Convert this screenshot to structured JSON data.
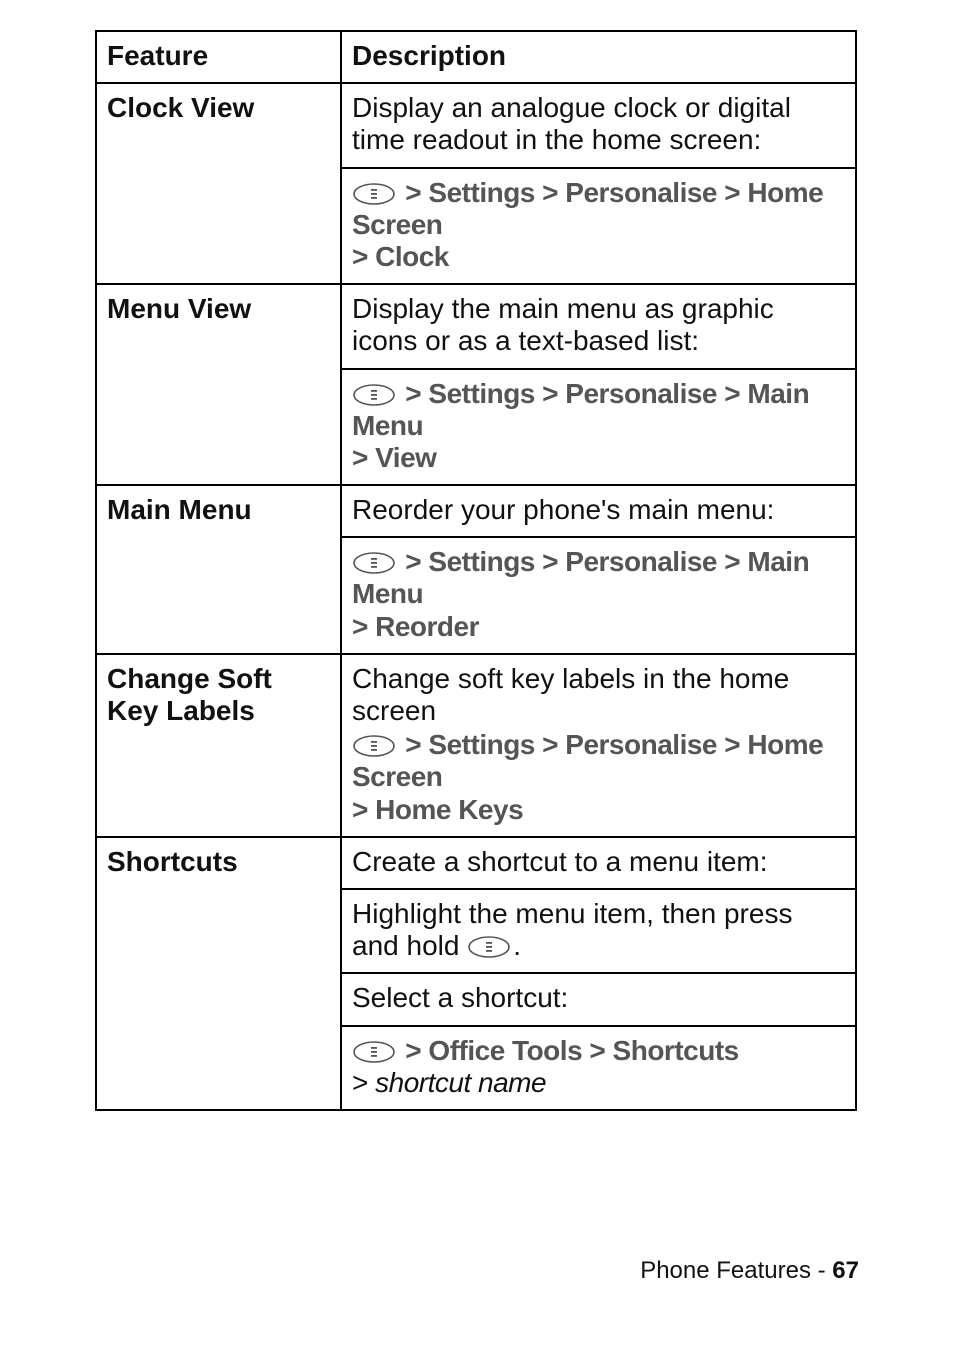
{
  "header": {
    "feature": "Feature",
    "description": "Description"
  },
  "rows": [
    {
      "feature": "Clock View",
      "intro": "Display an analogue clock or digital time readout in the home screen:",
      "path_prefix": " > ",
      "path_main": "Settings > Personalise > Home Screen",
      "path_cont": "> Clock"
    },
    {
      "feature": "Menu View",
      "intro": "Display the main menu as graphic icons or as a text-based list:",
      "path_prefix": " > ",
      "path_main": "Settings > Personalise > Main Menu",
      "path_cont": "> View"
    },
    {
      "feature": "Main Menu",
      "intro": "Reorder your phone's main menu:",
      "path_prefix": " > ",
      "path_main": "Settings > Personalise > Main Menu",
      "path_cont": "> Reorder"
    },
    {
      "feature": "Change Soft Key Labels",
      "intro": "Change soft key labels in the home screen",
      "path_prefix": " > ",
      "path_main": "Settings > Personalise > Home Screen",
      "path_cont": "> Home Keys"
    },
    {
      "feature": "Shortcuts",
      "intro": "Create a shortcut to a menu item:",
      "line2a": "Highlight the menu item, then press and hold ",
      "line2b": ".",
      "line3": "Select a shortcut:",
      "path_prefix": " > ",
      "path_main": "Office Tools > Shortcuts",
      "path_cont_prefix": "> ",
      "path_cont_italic": "shortcut name"
    }
  ],
  "footer": {
    "section": "Phone Features - ",
    "page": "67"
  }
}
